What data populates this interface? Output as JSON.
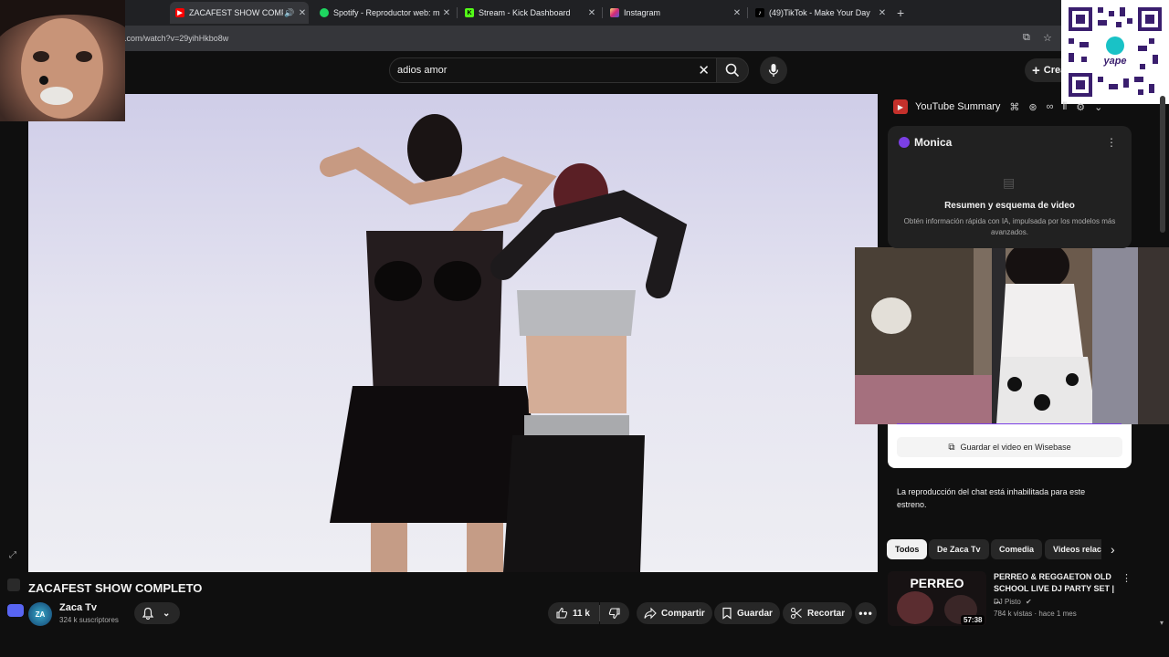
{
  "tabs": [
    {
      "title": "ZACAFEST SHOW COMPLETO",
      "favicon": "youtube-icon",
      "active": true
    },
    {
      "title": "Spotify - Reproductor web: mú",
      "favicon": "spotify-icon",
      "active": false
    },
    {
      "title": "Stream - Kick Dashboard",
      "favicon": "kick-icon",
      "active": false
    },
    {
      "title": "Instagram",
      "favicon": "instagram-icon",
      "active": false
    },
    {
      "title": "(49)TikTok - Make Your Day",
      "favicon": "tiktok-icon",
      "active": false
    }
  ],
  "address": {
    "url": ".com/watch?v=29yihHkbo8w"
  },
  "search": {
    "query": "adios amor"
  },
  "header": {
    "create_label": "Crear"
  },
  "extension": {
    "title": "YouTube Summary"
  },
  "monica": {
    "name": "Monica",
    "card_title": "Resumen y esquema de video",
    "card_desc": "Obtén información rápida con IA, impulsada por los modelos más avanzados.",
    "save_label": "Guardar el video en Wisebase"
  },
  "chat": {
    "disabled_text": "La reproducción del chat está inhabilitada para este estreno."
  },
  "chips": [
    "Todos",
    "De Zaca Tv",
    "Comedia",
    "Videos relac"
  ],
  "video": {
    "title": "ZACAFEST SHOW COMPLETO",
    "channel": "Zaca Tv",
    "subscribers": "324 k suscriptores",
    "likes": "11 k",
    "share_label": "Compartir",
    "save_label": "Guardar",
    "clip_label": "Recortar"
  },
  "recommendation": {
    "title": "PERREO & REGGAETON OLD SCHOOL LIVE DJ PARTY SET | ...",
    "channel": "DJ Pisto",
    "meta": "784 k vistas · hace 1 mes",
    "duration": "57:38",
    "thumb_text": "PERREO"
  },
  "qr": {
    "label": "yape"
  },
  "colors": {
    "youtube_red": "#ff0000",
    "spotify_green": "#1ed760",
    "kick_green": "#53fc18",
    "monica_purple": "#7b3fe4"
  }
}
